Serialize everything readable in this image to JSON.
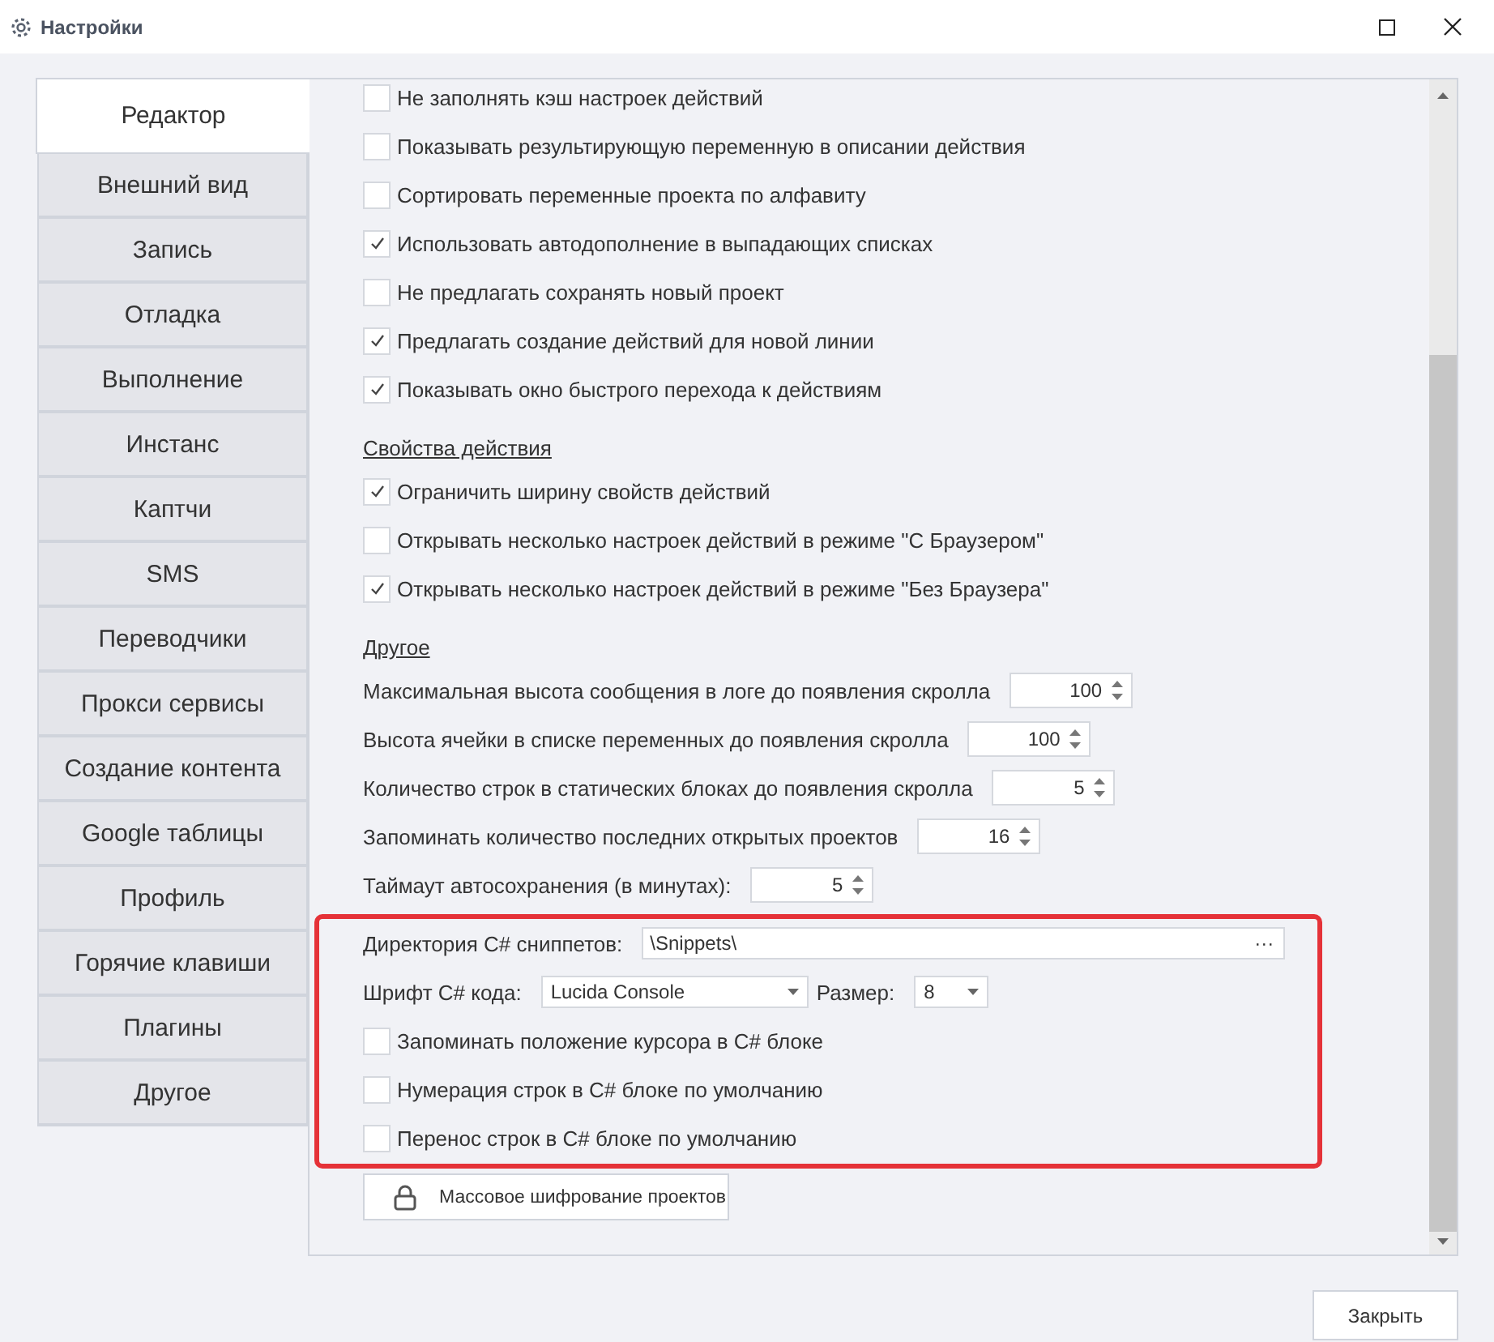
{
  "window": {
    "title": "Настройки"
  },
  "tabs": [
    {
      "label": "Редактор",
      "selected": true
    },
    {
      "label": "Внешний вид",
      "selected": false
    },
    {
      "label": "Запись",
      "selected": false
    },
    {
      "label": "Отладка",
      "selected": false
    },
    {
      "label": "Выполнение",
      "selected": false
    },
    {
      "label": "Инстанс",
      "selected": false
    },
    {
      "label": "Каптчи",
      "selected": false
    },
    {
      "label": "SMS",
      "selected": false
    },
    {
      "label": "Переводчики",
      "selected": false
    },
    {
      "label": "Прокси сервисы",
      "selected": false
    },
    {
      "label": "Создание контента",
      "selected": false
    },
    {
      "label": "Google таблицы",
      "selected": false
    },
    {
      "label": "Профиль",
      "selected": false
    },
    {
      "label": "Горячие клавиши",
      "selected": false
    },
    {
      "label": "Плагины",
      "selected": false
    },
    {
      "label": "Другое",
      "selected": false
    }
  ],
  "editor_options": [
    {
      "label": "Не заполнять кэш настроек действий",
      "checked": false
    },
    {
      "label": "Показывать результирующую переменную в описании действия",
      "checked": false
    },
    {
      "label": "Сортировать переменные проекта по алфавиту",
      "checked": false
    },
    {
      "label": "Использовать автодополнение в выпадающих списках",
      "checked": true
    },
    {
      "label": "Не предлагать сохранять новый проект",
      "checked": false
    },
    {
      "label": "Предлагать создание действий для новой линии",
      "checked": true
    },
    {
      "label": "Показывать окно быстрого перехода к действиям",
      "checked": true
    }
  ],
  "action_properties": {
    "heading": "Свойства действия",
    "options": [
      {
        "label": "Ограничить ширину свойств действий",
        "checked": true
      },
      {
        "label": "Открывать несколько настроек действий в режиме \"С Браузером\"",
        "checked": false
      },
      {
        "label": "Открывать несколько настроек действий в режиме \"Без Браузера\"",
        "checked": true
      }
    ]
  },
  "other": {
    "heading": "Другое",
    "spinners": [
      {
        "label": "Максимальная высота сообщения в логе до появления скролла",
        "value": "100"
      },
      {
        "label": "Высота ячейки в списке переменных до появления скролла",
        "value": "100"
      },
      {
        "label": "Количество строк в статических блоках до появления скролла",
        "value": "5"
      },
      {
        "label": "Запоминать количество последних открытых проектов",
        "value": "16"
      },
      {
        "label": "Таймаут автосохранения (в минутах):",
        "value": "5"
      }
    ]
  },
  "csharp": {
    "highlighted": true,
    "snippets_dir": {
      "label": "Директория C# сниппетов:",
      "value": "\\Snippets\\",
      "browse": "···"
    },
    "font": {
      "label": "Шрифт C# кода:",
      "value": "Lucida Console",
      "size_label": "Размер:",
      "size_value": "8"
    },
    "options": [
      {
        "label": "Запоминать положение курсора в C# блоке",
        "checked": false
      },
      {
        "label": "Нумерация строк в C# блоке по умолчанию",
        "checked": false
      },
      {
        "label": "Перенос строк в C# блоке по умолчанию",
        "checked": false
      }
    ]
  },
  "encrypt_button": "Массовое шифрование проектов",
  "close_button": "Закрыть"
}
